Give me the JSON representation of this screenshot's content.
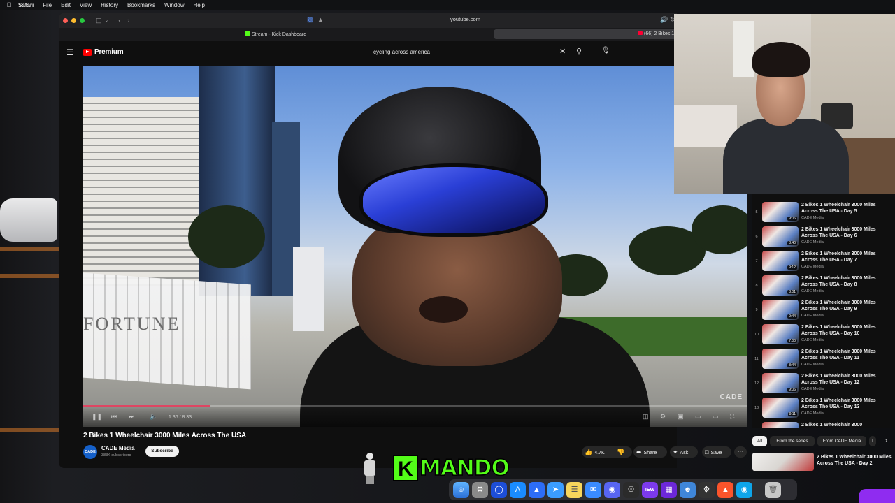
{
  "menubar": {
    "apple": "",
    "items": [
      "Safari",
      "File",
      "Edit",
      "View",
      "History",
      "Bookmarks",
      "Window",
      "Help"
    ]
  },
  "browser": {
    "url": "youtube.com",
    "tab_active": "Stream - Kick Dashboard",
    "tab_youtube": "(66) 2 Bikes 1"
  },
  "youtube": {
    "logo": "Premium",
    "search_value": "cycling across america",
    "video": {
      "title": "2 Bikes 1 Wheelchair 3000 Miles Across The USA",
      "watermark": "CADE",
      "time": "1:36 / 8:33",
      "progress": 0.19,
      "scene_sign": "FORTUNE"
    },
    "channel": {
      "avatar": "CADE",
      "name": "CADE Media",
      "subscribers": "383K subscribers",
      "subscribe": "Subscribe"
    },
    "actions": {
      "likes": "4.7K",
      "share": "Share",
      "ask": "Ask",
      "save": "Save",
      "more": "···"
    },
    "playlist": [
      {
        "num": "5",
        "title": "2 Bikes 1 Wheelchair 3000 Miles Across The USA - Day 5",
        "channel": "CADE Media",
        "badge": "9:06"
      },
      {
        "num": "6",
        "title": "2 Bikes 1 Wheelchair 3000 Miles Across The USA - Day 6",
        "channel": "CADE Media",
        "badge": "8:40"
      },
      {
        "num": "7",
        "title": "2 Bikes 1 Wheelchair 3000 Miles Across The USA - Day 7",
        "channel": "CADE Media",
        "badge": "9:12"
      },
      {
        "num": "8",
        "title": "2 Bikes 1 Wheelchair 3000 Miles Across The USA - Day 8",
        "channel": "CADE Media",
        "badge": "8:01"
      },
      {
        "num": "9",
        "title": "2 Bikes 1 Wheelchair 3000 Miles Across The USA - Day 9",
        "channel": "CADE Media",
        "badge": "9:44"
      },
      {
        "num": "10",
        "title": "2 Bikes 1 Wheelchair 3000 Miles Across The USA - Day 10",
        "channel": "CADE Media",
        "badge": "7:00"
      },
      {
        "num": "11",
        "title": "2 Bikes 1 Wheelchair 3000 Miles Across The USA - Day 11",
        "channel": "CADE Media",
        "badge": "8:44"
      },
      {
        "num": "12",
        "title": "2 Bikes 1 Wheelchair 3000 Miles Across The USA - Day 12",
        "channel": "CADE Media",
        "badge": "9:06"
      },
      {
        "num": "13",
        "title": "2 Bikes 1 Wheelchair 3000 Miles Across The USA - Day 13",
        "channel": "CADE Media",
        "badge": "9:11"
      },
      {
        "num": "",
        "title": "2 Bikes 1 Wheelchair 3000",
        "channel": "",
        "badge": ""
      }
    ],
    "chips": [
      "All",
      "From the series",
      "From CADE Media",
      "T"
    ],
    "recommended": {
      "title": "2 Bikes 1 Wheelchair 3000 Miles Across The USA - Day 2"
    }
  },
  "overlay": {
    "kick_k": "K",
    "kick_name": "MANDO"
  },
  "dock": {
    "icons": [
      "finder-icon",
      "launchpad-icon",
      "bitwarden-icon",
      "app-store-icon",
      "arc-icon",
      "safari-icon",
      "notes-icon",
      "mail-icon",
      "discord-icon",
      "obs-icon",
      "iew-icon",
      "grid-icon",
      "finder-alt-icon",
      "cpu-icon",
      "brave-icon",
      "camera-icon",
      "trash-icon"
    ],
    "iew_label": "IEW"
  },
  "colors": {
    "youtube_red": "#ff0000",
    "kick_green": "#53fc18",
    "background": "#0f0f0f"
  }
}
